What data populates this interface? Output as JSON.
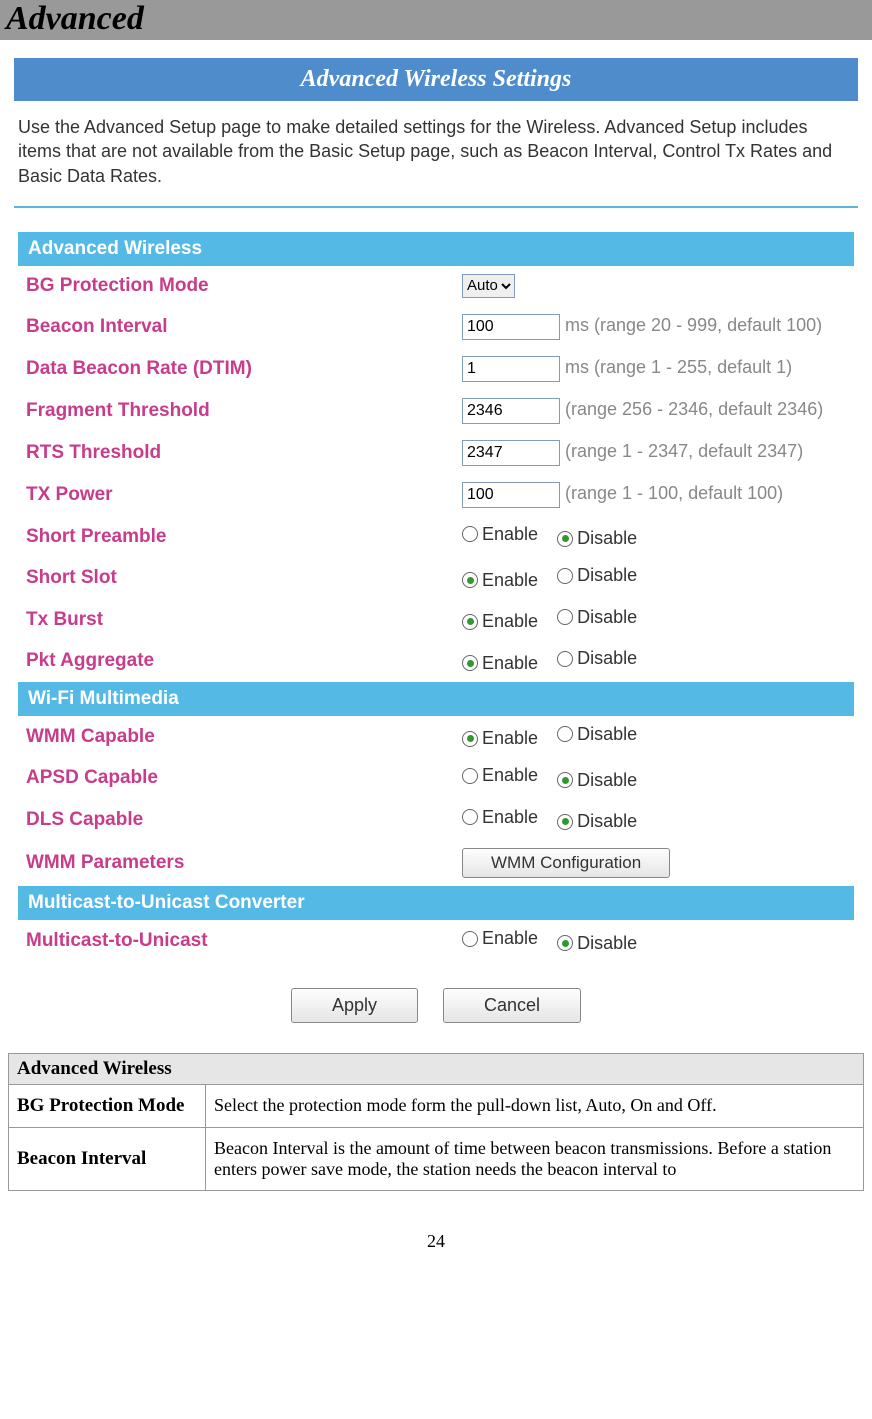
{
  "title": "Advanced",
  "panel_title": "Advanced Wireless Settings",
  "intro": "Use the Advanced Setup page to make detailed settings for the Wireless. Advanced Setup includes items that are not available from the Basic Setup page, such as Beacon Interval, Control Tx Rates and Basic Data Rates.",
  "sections": {
    "advanced": {
      "header": "Advanced Wireless",
      "bg_protection": {
        "label": "BG Protection Mode",
        "value": "Auto"
      },
      "beacon_interval": {
        "label": "Beacon Interval",
        "value": "100",
        "hint": "ms (range 20 - 999, default 100)"
      },
      "dtim": {
        "label": "Data Beacon Rate (DTIM)",
        "value": "1",
        "hint": "ms (range 1 - 255, default 1)"
      },
      "fragment": {
        "label": "Fragment Threshold",
        "value": "2346",
        "hint": "(range 256 - 2346, default 2346)"
      },
      "rts": {
        "label": "RTS Threshold",
        "value": "2347",
        "hint": "(range 1 - 2347, default 2347)"
      },
      "txpower": {
        "label": "TX Power",
        "value": "100",
        "hint": "(range 1 - 100, default 100)"
      },
      "short_preamble": {
        "label": "Short Preamble",
        "enable": "Enable",
        "disable": "Disable",
        "selected": "disable"
      },
      "short_slot": {
        "label": "Short Slot",
        "enable": "Enable",
        "disable": "Disable",
        "selected": "enable"
      },
      "tx_burst": {
        "label": "Tx Burst",
        "enable": "Enable",
        "disable": "Disable",
        "selected": "enable"
      },
      "pkt_aggregate": {
        "label": "Pkt Aggregate",
        "enable": "Enable",
        "disable": "Disable",
        "selected": "enable"
      }
    },
    "wmm": {
      "header": "Wi-Fi Multimedia",
      "wmm_capable": {
        "label": "WMM Capable",
        "enable": "Enable",
        "disable": "Disable",
        "selected": "enable"
      },
      "apsd_capable": {
        "label": "APSD Capable",
        "enable": "Enable",
        "disable": "Disable",
        "selected": "disable"
      },
      "dls_capable": {
        "label": "DLS Capable",
        "enable": "Enable",
        "disable": "Disable",
        "selected": "disable"
      },
      "wmm_params": {
        "label": "WMM Parameters",
        "button": "WMM Configuration"
      }
    },
    "multicast": {
      "header": "Multicast-to-Unicast Converter",
      "m2u": {
        "label": "Multicast-to-Unicast",
        "enable": "Enable",
        "disable": "Disable",
        "selected": "disable"
      }
    }
  },
  "buttons": {
    "apply": "Apply",
    "cancel": "Cancel"
  },
  "doc": {
    "header": "Advanced Wireless",
    "rows": [
      {
        "name": "BG Protection Mode",
        "desc": "Select the protection mode form the pull-down list, Auto, On and Off."
      },
      {
        "name": "Beacon Interval",
        "desc": "Beacon Interval is the amount of time between beacon transmissions. Before a station enters power save mode, the station needs the beacon interval to"
      }
    ]
  },
  "page_number": "24"
}
